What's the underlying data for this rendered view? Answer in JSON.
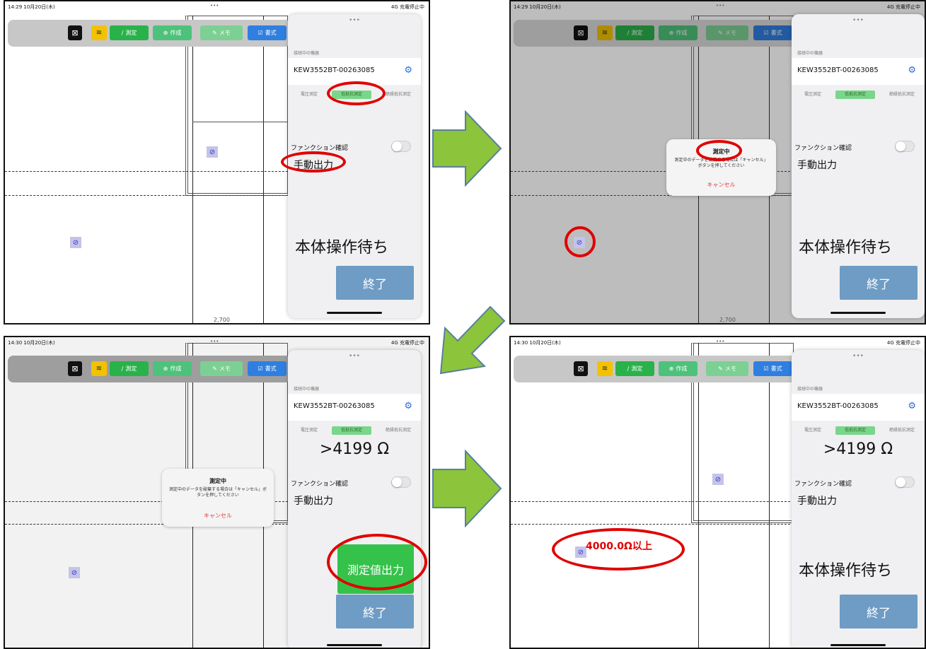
{
  "panel1": {
    "status": {
      "time": "14:29  10月20日(木)",
      "right": "4G 充電停止中"
    },
    "toolbar": {
      "measure": "測定",
      "create": "作成",
      "memo": "メモ",
      "format": "書式"
    },
    "sheet": {
      "caption": "接続中の機器",
      "device": "KEW3552BT-00263085",
      "tabs": [
        "電圧測定",
        "低抵抗測定",
        "絶縁抵抗測定"
      ],
      "function_check": "ファンクション確認",
      "manual_output": "手動出力",
      "waiting": "本体操作待ち",
      "end": "終了"
    }
  },
  "panel2": {
    "status": {
      "time": "14:29  10月20日(木)",
      "right": "4G 充電停止中"
    },
    "toolbar": {
      "measure": "測定",
      "create": "作成",
      "memo": "メモ",
      "format": "書式"
    },
    "dialog": {
      "title": "測定中",
      "body": "測定中のデータを破棄する場合は「キャンセル」ボタンを押してください",
      "cancel": "キャンセル"
    },
    "sheet": {
      "caption": "接続中の機器",
      "device": "KEW3552BT-00263085",
      "tabs": [
        "電圧測定",
        "低抵抗測定",
        "絶縁抵抗測定"
      ],
      "function_check": "ファンクション確認",
      "manual_output": "手動出力",
      "waiting": "本体操作待ち",
      "end": "終了"
    }
  },
  "panel3": {
    "status": {
      "time": "14:30  10月20日(木)",
      "right": "4G 充電停止中"
    },
    "toolbar": {
      "measure": "測定",
      "create": "作成",
      "memo": "メモ",
      "format": "書式"
    },
    "dialog": {
      "title": "測定中",
      "body": "測定中のデータを破棄する場合は「キャンセル」ボタンを押してください",
      "cancel": "キャンセル"
    },
    "sheet": {
      "caption": "接続中の機器",
      "device": "KEW3552BT-00263085",
      "tabs": [
        "電圧測定",
        "低抵抗測定",
        "絶縁抵抗測定"
      ],
      "reading": ">4199 Ω",
      "function_check": "ファンクション確認",
      "manual_output": "手動出力",
      "output_button": "測定値出力",
      "end": "終了"
    }
  },
  "panel4": {
    "status": {
      "time": "14:30  10月20日(木)",
      "right": "4G 充電停止中"
    },
    "toolbar": {
      "measure": "測定",
      "create": "作成",
      "memo": "メモ",
      "format": "書式"
    },
    "result": "4000.0Ω以上",
    "sheet": {
      "caption": "接続中の機器",
      "device": "KEW3552BT-00263085",
      "tabs": [
        "電圧測定",
        "低抵抗測定",
        "絶縁抵抗測定"
      ],
      "reading": ">4199 Ω",
      "function_check": "ファンクション確認",
      "manual_output": "手動出力",
      "waiting": "本体操作待ち",
      "end": "終了"
    }
  },
  "dim_labels": [
    "2,700",
    "2,700"
  ],
  "colors": {
    "annotation": "#e00000",
    "arrow": "#8cc43c",
    "arrow_border": "#5a7f9e"
  }
}
